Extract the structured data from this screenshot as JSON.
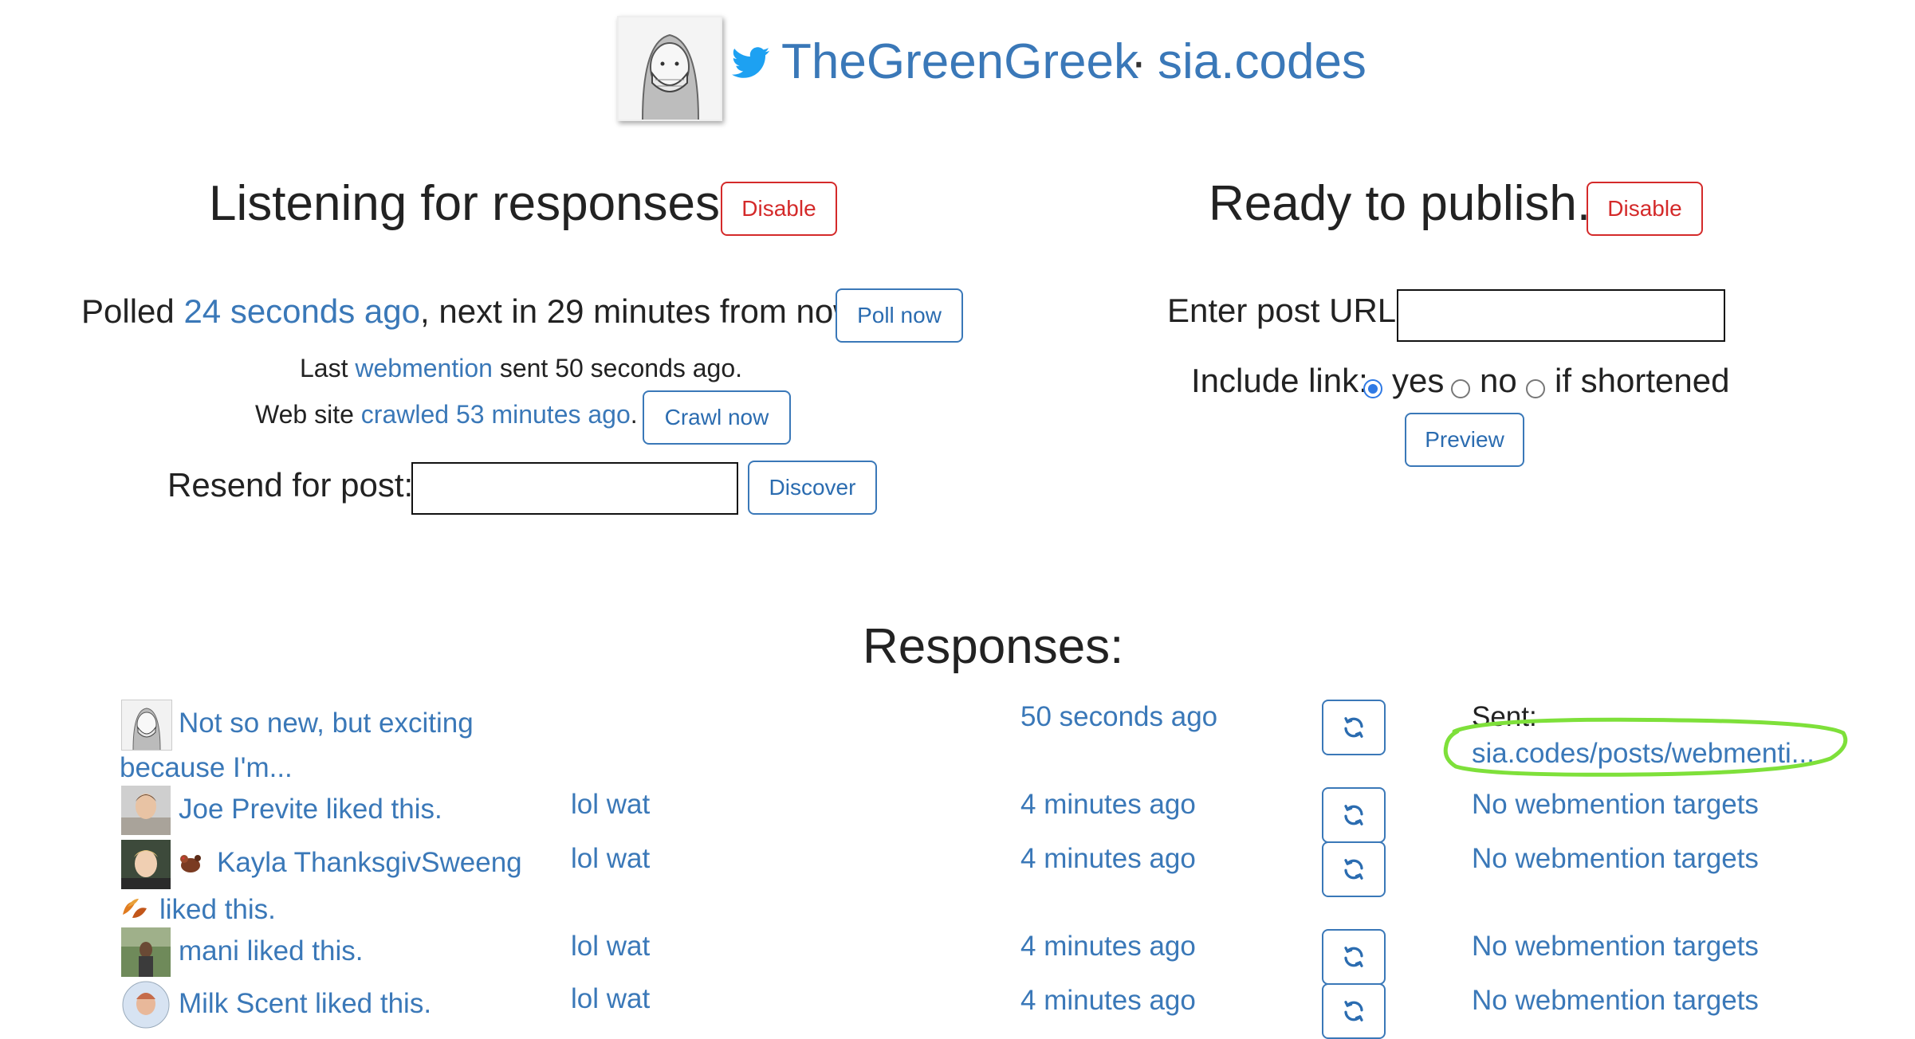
{
  "header": {
    "username": "TheGreenGreek",
    "separator": "·",
    "site": "sia.codes"
  },
  "listen": {
    "heading": "Listening for responses.",
    "disable_label": "Disable",
    "polled_prefix": "Polled",
    "polled_link": "24 seconds ago",
    "polled_suffix": ", next in 29 minutes from now.",
    "poll_now_label": "Poll now",
    "last_prefix": "Last",
    "last_link": "webmention",
    "last_suffix": "sent 50 seconds ago.",
    "crawl_prefix": "Web site",
    "crawl_link": "crawled 53 minutes ago",
    "crawl_suffix": ".",
    "crawl_now_label": "Crawl now",
    "resend_label": "Resend for post:",
    "resend_value": "",
    "discover_label": "Discover"
  },
  "publish": {
    "heading": "Ready to publish.",
    "disable_label": "Disable",
    "url_label": "Enter post URL:",
    "url_value": "",
    "include_label": "Include link:",
    "options": [
      "yes",
      "no",
      "if shortened"
    ],
    "selected_option": "yes",
    "preview_label": "Preview"
  },
  "responses": {
    "heading": "Responses:",
    "rows": [
      {
        "text_line1": "Not so new, but exciting",
        "text_line2": "because I'm...",
        "content": "",
        "time": "50 seconds ago",
        "status_label": "Sent:",
        "status": "sia.codes/posts/webmenti..."
      },
      {
        "text_line1": "Joe Previte liked this.",
        "text_line2": "",
        "content": "lol wat",
        "time": "4 minutes ago",
        "status_label": "",
        "status": "No webmention targets"
      },
      {
        "text_line1": "Kayla ThanksgivSweeng",
        "text_line2": "liked this.",
        "content": "lol wat",
        "time": "4 minutes ago",
        "status_label": "",
        "status": "No webmention targets"
      },
      {
        "text_line1": "mani liked this.",
        "text_line2": "",
        "content": "lol wat",
        "time": "4 minutes ago",
        "status_label": "",
        "status": "No webmention targets"
      },
      {
        "text_line1": "Milk Scent liked this.",
        "text_line2": "",
        "content": "lol wat",
        "time": "4 minutes ago",
        "status_label": "",
        "status": "No webmention targets"
      }
    ]
  },
  "colors": {
    "link": "#3a78b8",
    "danger": "#d42a2a",
    "highlight": "#7ee03a",
    "radio": "#2f7ae5"
  },
  "icons": {
    "twitter": "twitter-bird-icon",
    "refresh": "refresh-icon",
    "turkey": "turkey-emoji-icon",
    "leaves": "fallen-leaves-emoji-icon"
  }
}
